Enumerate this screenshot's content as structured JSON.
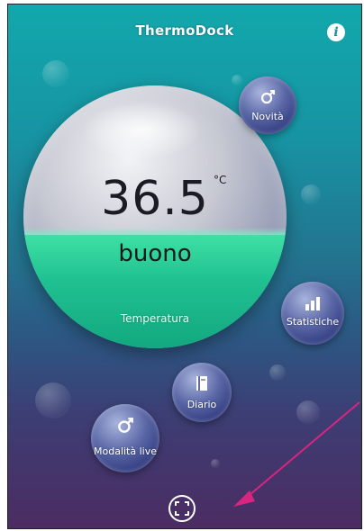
{
  "header": {
    "title": "ThermoDock",
    "info_label": "i"
  },
  "main": {
    "temperature": "36.5",
    "unit": "°C",
    "status": "buono",
    "caption": "Temperatura",
    "fill_fraction": 0.43
  },
  "menu": {
    "news_label": "Novità",
    "stats_label": "Statistiche",
    "diary_label": "Diario",
    "live_mode_label": "Modalità live"
  },
  "colors": {
    "accent": "#1fc191",
    "background_top": "#12a8ac",
    "background_bottom": "#4b2c62",
    "arrow": "#d8257f"
  },
  "icons": {
    "info": "info-icon",
    "news": "gender-icon",
    "stats": "bar-chart-icon",
    "diary": "book-icon",
    "live_mode": "gender-icon",
    "fullscreen": "fullscreen-icon"
  }
}
